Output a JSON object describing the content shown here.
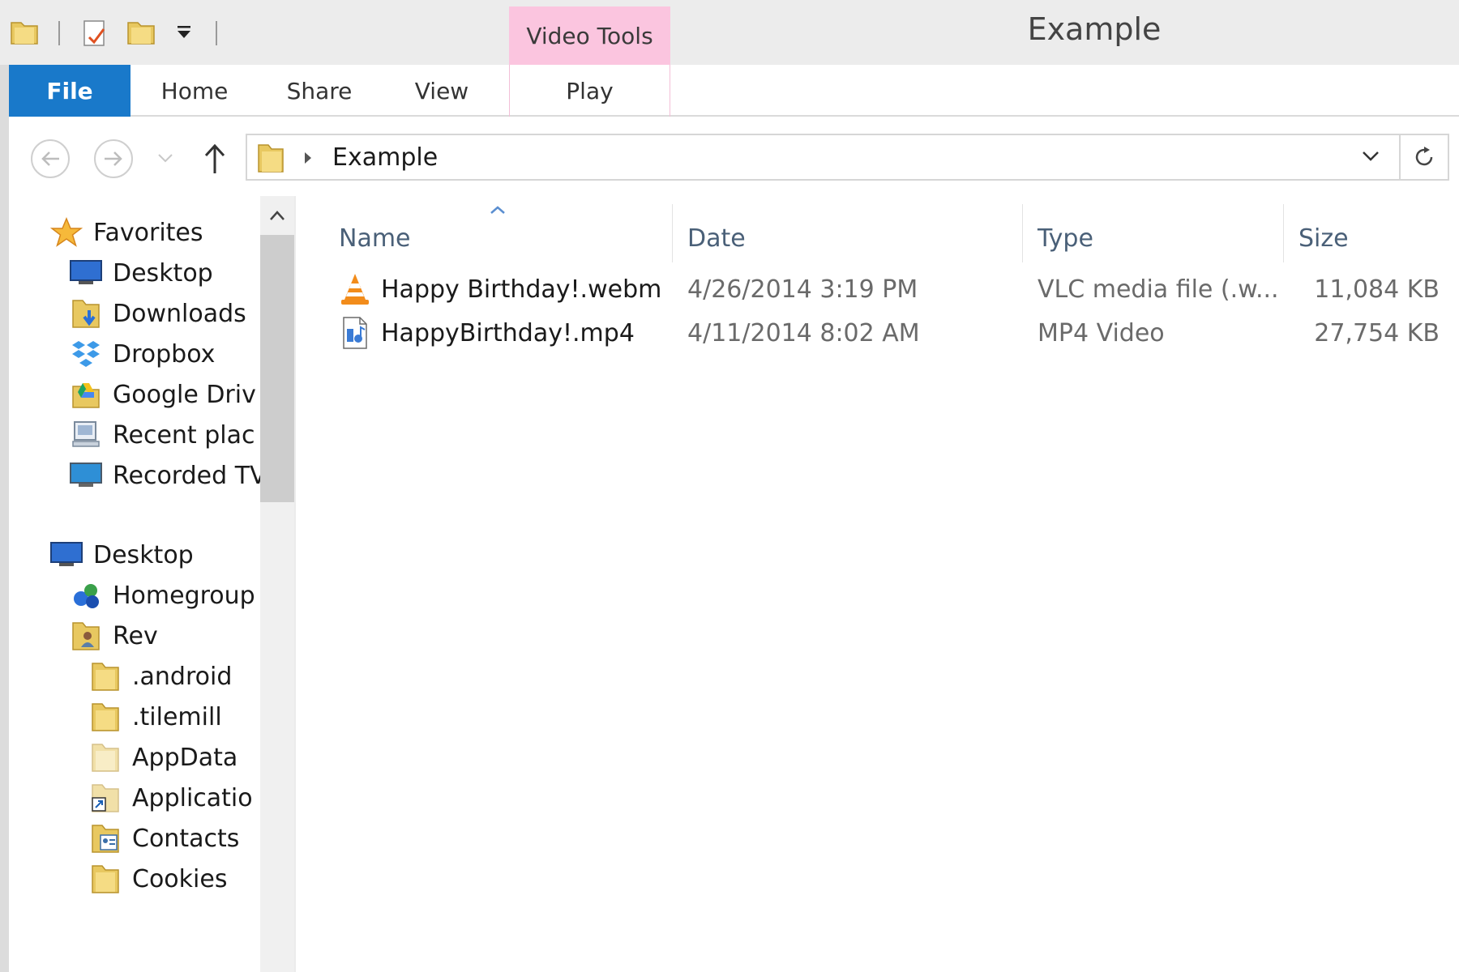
{
  "window": {
    "title": "Example"
  },
  "ribbon": {
    "context_group": "Video Tools",
    "tabs": [
      {
        "label": "File"
      },
      {
        "label": "Home"
      },
      {
        "label": "Share"
      },
      {
        "label": "View"
      },
      {
        "label": "Play"
      }
    ]
  },
  "address": {
    "path": "Example"
  },
  "nav_pane": {
    "items": [
      {
        "label": "Favorites",
        "icon": "star-icon"
      },
      {
        "label": "Desktop",
        "icon": "desktop-icon"
      },
      {
        "label": "Downloads",
        "icon": "downloads-folder-icon"
      },
      {
        "label": "Dropbox",
        "icon": "dropbox-icon"
      },
      {
        "label": "Google Driv",
        "icon": "google-drive-icon"
      },
      {
        "label": "Recent plac",
        "icon": "recent-places-icon"
      },
      {
        "label": "Recorded TV",
        "icon": "recorded-tv-icon"
      },
      {
        "label": "Desktop",
        "icon": "desktop-icon"
      },
      {
        "label": "Homegroup",
        "icon": "homegroup-icon"
      },
      {
        "label": "Rev",
        "icon": "user-folder-icon"
      },
      {
        "label": ".android",
        "icon": "folder-icon"
      },
      {
        "label": ".tilemill",
        "icon": "folder-icon"
      },
      {
        "label": "AppData",
        "icon": "folder-icon"
      },
      {
        "label": "Applicatio",
        "icon": "shortcut-icon"
      },
      {
        "label": "Contacts",
        "icon": "contacts-folder-icon"
      },
      {
        "label": "Cookies",
        "icon": "folder-icon"
      }
    ]
  },
  "file_list": {
    "columns": {
      "name": "Name",
      "date": "Date",
      "type": "Type",
      "size": "Size"
    },
    "rows": [
      {
        "name": "Happy Birthday!.webm",
        "date": "4/26/2014 3:19 PM",
        "type": "VLC media file (.w...",
        "size": "11,084 KB",
        "icon": "vlc-cone-icon"
      },
      {
        "name": "HappyBirthday!.mp4",
        "date": "4/11/2014 8:02 AM",
        "type": "MP4 Video",
        "size": "27,754 KB",
        "icon": "video-file-icon"
      }
    ]
  },
  "colors": {
    "file_tab": "#1979ca",
    "context_tab": "#fbc5df",
    "header_text": "#4a6078"
  }
}
